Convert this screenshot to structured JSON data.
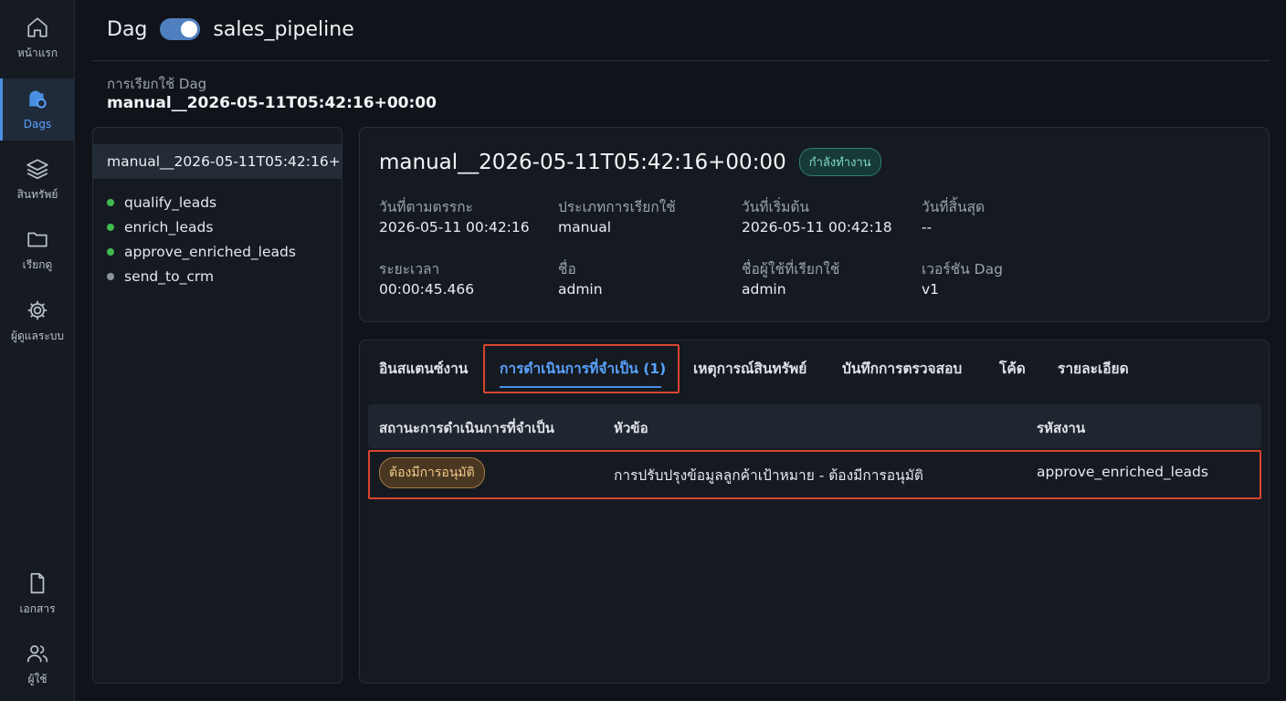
{
  "nav": {
    "items": [
      {
        "label": "หน้าแรก",
        "icon": "home-icon"
      },
      {
        "label": "Dags",
        "icon": "dags-icon"
      },
      {
        "label": "สินทรัพย์",
        "icon": "assets-icon"
      },
      {
        "label": "เรียกดู",
        "icon": "folder-icon"
      },
      {
        "label": "ผู้ดูแลระบบ",
        "icon": "gear-icon"
      },
      {
        "label": "เอกสาร",
        "icon": "document-icon"
      },
      {
        "label": "ผู้ใช้",
        "icon": "users-icon"
      }
    ],
    "active_index": 1
  },
  "header": {
    "dag_word": "Dag",
    "toggle_on": true,
    "dag_name": "sales_pipeline"
  },
  "run": {
    "label": "การเรียกใช้ Dag",
    "id": "manual__2026-05-11T05:42:16+00:00"
  },
  "left_panel": {
    "selected_run": "manual__2026-05-11T05:42:16+",
    "tasks": [
      {
        "name": "qualify_leads",
        "status_color": "#3fb950"
      },
      {
        "name": "enrich_leads",
        "status_color": "#3fb950"
      },
      {
        "name": "approve_enriched_leads",
        "status_color": "#3fb950"
      },
      {
        "name": "send_to_crm",
        "status_color": "#8b949e"
      }
    ]
  },
  "details": {
    "title": "manual__2026-05-11T05:42:16+00:00",
    "status_badge": "กำลังทำงาน",
    "fields": [
      {
        "key": "วันที่ตามตรรกะ",
        "value": "2026-05-11 00:42:16"
      },
      {
        "key": "ประเภทการเรียกใช้",
        "value": "manual"
      },
      {
        "key": "วันที่เริ่มต้น",
        "value": "2026-05-11 00:42:18"
      },
      {
        "key": "วันที่สิ้นสุด",
        "value": "--"
      },
      {
        "key": "ระยะเวลา",
        "value": "00:00:45.466"
      },
      {
        "key": "ชื่อ",
        "value": "admin"
      },
      {
        "key": "ชื่อผู้ใช้ที่เรียกใช้",
        "value": "admin"
      },
      {
        "key": "เวอร์ชัน Dag",
        "value": "v1"
      }
    ]
  },
  "tabs": [
    {
      "label": "อินสแตนซ์งาน"
    },
    {
      "label": "การดำเนินการที่จำเป็น (1)"
    },
    {
      "label": "เหตุการณ์สินทรัพย์"
    },
    {
      "label": "บันทึกการตรวจสอบ"
    },
    {
      "label": "โค้ด"
    },
    {
      "label": "รายละเอียด"
    }
  ],
  "active_tab": 1,
  "table": {
    "columns": [
      "สถานะการดำเนินการที่จำเป็น",
      "หัวข้อ",
      "รหัสงาน"
    ],
    "rows": [
      {
        "status": "ต้องมีการอนุมัติ",
        "subject": "การปรับปรุงข้อมูลลูกค้าเป้าหมาย - ต้องมีการอนุมัติ",
        "task_id": "approve_enriched_leads"
      }
    ]
  }
}
